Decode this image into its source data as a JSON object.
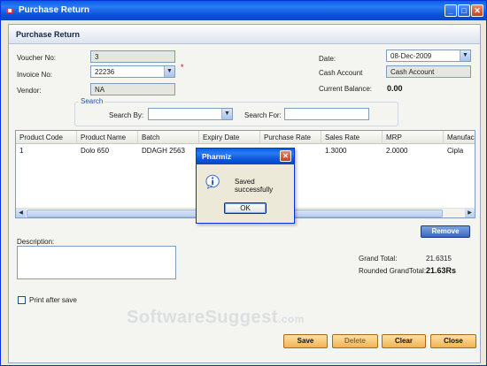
{
  "window": {
    "title": "Purchase Return"
  },
  "section": {
    "title": "Purchase Return"
  },
  "form": {
    "voucher_no_label": "Voucher No:",
    "voucher_no": "3",
    "invoice_no_label": "Invoice No:",
    "invoice_no": "22236",
    "required_mark": "*",
    "vendor_label": "Vendor:",
    "vendor": "NA",
    "date_label": "Date:",
    "date": "08-Dec-2009",
    "cash_account_label": "Cash Account",
    "cash_account": "Cash Account",
    "current_balance_label": "Current Balance:",
    "current_balance": "0.00"
  },
  "search": {
    "legend": "Search",
    "search_by_label": "Search By:",
    "search_by_value": "",
    "search_for_label": "Search For:",
    "search_for_value": ""
  },
  "grid": {
    "columns": [
      "Product Code",
      "Product Name",
      "Batch",
      "Expiry Date",
      "Purchase Rate",
      "Sales Rate",
      "MRP",
      "Manufac"
    ],
    "rows": [
      [
        "1",
        "Dolo 650",
        "DDAGH 2563",
        "",
        "",
        "1.3000",
        "2.0000",
        "Cipla"
      ]
    ]
  },
  "actions": {
    "remove": "Remove",
    "save": "Save",
    "delete": "Delete",
    "clear": "Clear",
    "close": "Close"
  },
  "description_label": "Description:",
  "totals": {
    "grand_total_label": "Grand Total:",
    "grand_total": "21.6315",
    "rounded_label": "Rounded GrandTotal:",
    "rounded": "21.63Rs"
  },
  "print_after_save_label": "Print after save",
  "watermark": {
    "text": "SoftwareSuggest",
    "suffix": ".com"
  },
  "dialog": {
    "title": "Pharmiz",
    "message": "Saved successfully",
    "ok": "OK",
    "icon": "info-icon"
  },
  "colors": {
    "titlebar": "#0a55d8",
    "button_blue": "#3b66bd",
    "button_orange": "#f3b253"
  }
}
